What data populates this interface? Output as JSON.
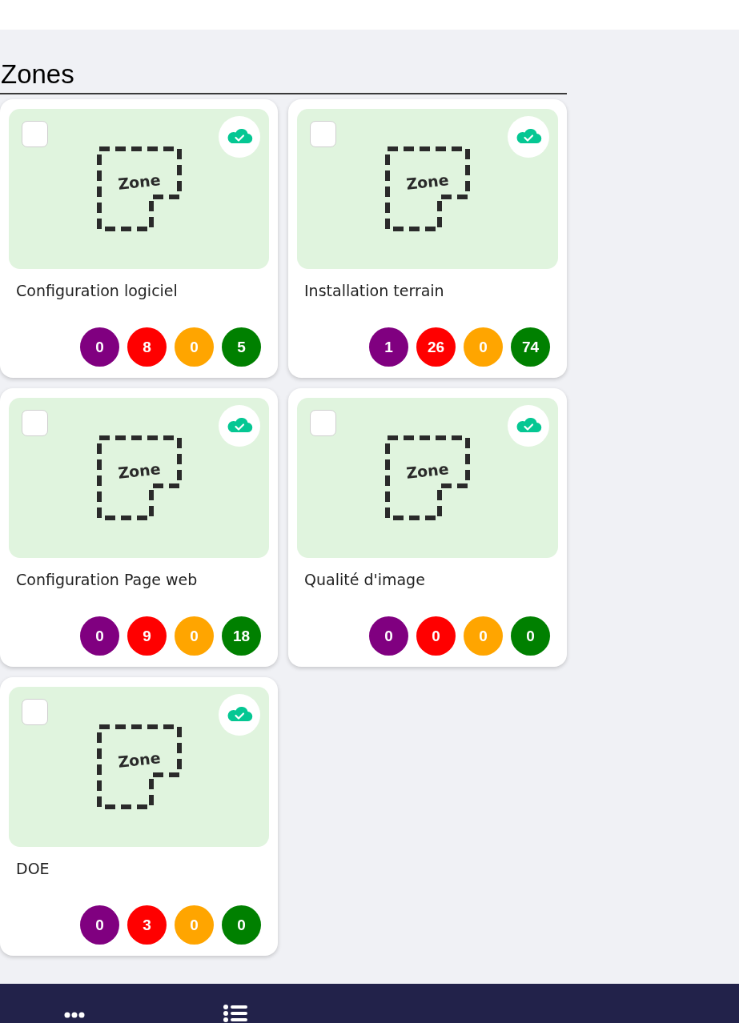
{
  "section": {
    "title": "Zones"
  },
  "zones": [
    {
      "name": "Configuration logiciel",
      "checked": false,
      "image_label": "Zone",
      "counts": [
        {
          "value": "0",
          "color": "#800080"
        },
        {
          "value": "8",
          "color": "#ff0000"
        },
        {
          "value": "0",
          "color": "#ffa500"
        },
        {
          "value": "5",
          "color": "#008000"
        }
      ]
    },
    {
      "name": "Installation terrain",
      "checked": false,
      "image_label": "Zone",
      "counts": [
        {
          "value": "1",
          "color": "#800080"
        },
        {
          "value": "26",
          "color": "#ff0000"
        },
        {
          "value": "0",
          "color": "#ffa500"
        },
        {
          "value": "74",
          "color": "#008000"
        }
      ]
    },
    {
      "name": "Configuration Page web",
      "checked": false,
      "image_label": "Zone",
      "counts": [
        {
          "value": "0",
          "color": "#800080"
        },
        {
          "value": "9",
          "color": "#ff0000"
        },
        {
          "value": "0",
          "color": "#ffa500"
        },
        {
          "value": "18",
          "color": "#008000"
        }
      ]
    },
    {
      "name": "Qualité d'image",
      "checked": false,
      "image_label": "Zone",
      "counts": [
        {
          "value": "0",
          "color": "#800080"
        },
        {
          "value": "0",
          "color": "#ff0000"
        },
        {
          "value": "0",
          "color": "#ffa500"
        },
        {
          "value": "0",
          "color": "#008000"
        }
      ]
    },
    {
      "name": "DOE",
      "checked": false,
      "image_label": "Zone",
      "counts": [
        {
          "value": "0",
          "color": "#800080"
        },
        {
          "value": "3",
          "color": "#ff0000"
        },
        {
          "value": "0",
          "color": "#ffa500"
        },
        {
          "value": "0",
          "color": "#008000"
        }
      ]
    }
  ]
}
